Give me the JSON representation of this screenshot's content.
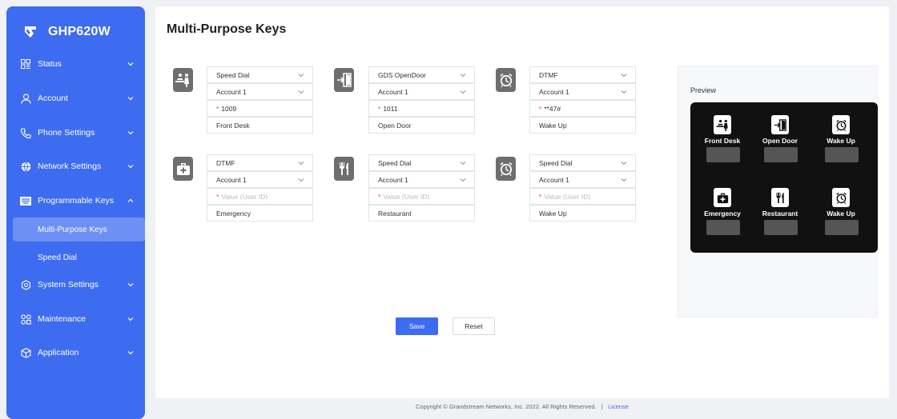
{
  "app": {
    "brand": "GHP620W"
  },
  "sidebar": {
    "items": [
      {
        "label": "Status",
        "icon": "status-grid-icon"
      },
      {
        "label": "Account",
        "icon": "user-icon"
      },
      {
        "label": "Phone Settings",
        "icon": "phone-icon"
      },
      {
        "label": "Network Settings",
        "icon": "globe-icon"
      },
      {
        "label": "Programmable Keys",
        "icon": "keyboard-icon",
        "expanded": true
      },
      {
        "label": "System Settings",
        "icon": "gear-icon"
      },
      {
        "label": "Maintenance",
        "icon": "maintenance-icon"
      },
      {
        "label": "Application",
        "icon": "cube-icon"
      }
    ],
    "sub_items": [
      {
        "label": "Multi-Purpose Keys",
        "active": true
      },
      {
        "label": "Speed Dial",
        "active": false
      }
    ]
  },
  "page": {
    "title": "Multi-Purpose Keys"
  },
  "keys": [
    {
      "icon": "front-desk-icon",
      "mode": "Speed Dial",
      "account": "Account 1",
      "value": "1009",
      "value_placeholder": "",
      "label": "Front Desk"
    },
    {
      "icon": "open-door-icon",
      "mode": "GDS OpenDoor",
      "account": "Account 1",
      "value": "1011",
      "value_placeholder": "",
      "label": "Open Door"
    },
    {
      "icon": "alarm-clock-icon",
      "mode": "DTMF",
      "account": "Account 1",
      "value": "**47#",
      "value_placeholder": "",
      "label": "Wake Up"
    },
    {
      "icon": "emergency-kit-icon",
      "mode": "DTMF",
      "account": "Account 1",
      "value": "",
      "value_placeholder": "Value (User ID)",
      "label": "Emergency"
    },
    {
      "icon": "restaurant-icon",
      "mode": "Speed Dial",
      "account": "Account 1",
      "value": "",
      "value_placeholder": "Value (User ID)",
      "label": "Restaurant"
    },
    {
      "icon": "alarm-clock-icon",
      "mode": "Speed Dial",
      "account": "Account 1",
      "value": "",
      "value_placeholder": "Value (User ID)",
      "label": "Wake Up"
    }
  ],
  "required_mark": "*",
  "actions": {
    "save": "Save",
    "reset": "Reset"
  },
  "preview": {
    "title": "Preview",
    "labels": [
      "Front Desk",
      "Open Door",
      "Wake Up",
      "Emergency",
      "Restaurant",
      "Wake Up"
    ]
  },
  "footer": {
    "copyright": "Copyright © Grandstream Networks, Inc. 2022. All Rights Reserved.",
    "separator": "|",
    "license": "License"
  },
  "colors": {
    "primary": "#3d6cf0",
    "active_sub": "#6d90f5",
    "required": "#e64c4c"
  }
}
